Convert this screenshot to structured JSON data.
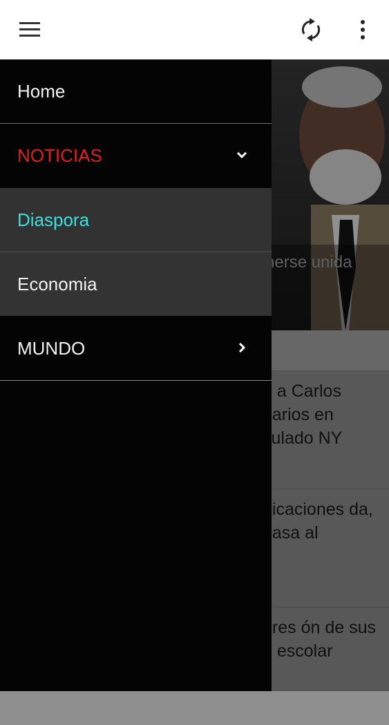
{
  "appbar": {
    "menu_icon": "hamburger-icon",
    "refresh_icon": "refresh-icon",
    "more_icon": "more-vertical-icon"
  },
  "drawer": {
    "items": [
      {
        "label": "Home"
      },
      {
        "label": "NOTICIAS",
        "expanded": true,
        "icon": "chevron-down-icon"
      },
      {
        "label": "Diaspora",
        "selected": true
      },
      {
        "label": "Economia"
      },
      {
        "label": "MUNDO",
        "icon": "chevron-right-icon"
      }
    ]
  },
  "background": {
    "hero_caption": "herse unida",
    "articles": [
      {
        "text": "e a Carlos narios en sulado NY"
      },
      {
        "text": "nicaciones da, pasa al"
      },
      {
        "text": "dres ón de sus o escolar"
      }
    ]
  },
  "colors": {
    "drawer_bg": "#050405",
    "noticias": "#e0201f",
    "diaspora": "#36e0e0",
    "submenu_bg": "#333333"
  }
}
